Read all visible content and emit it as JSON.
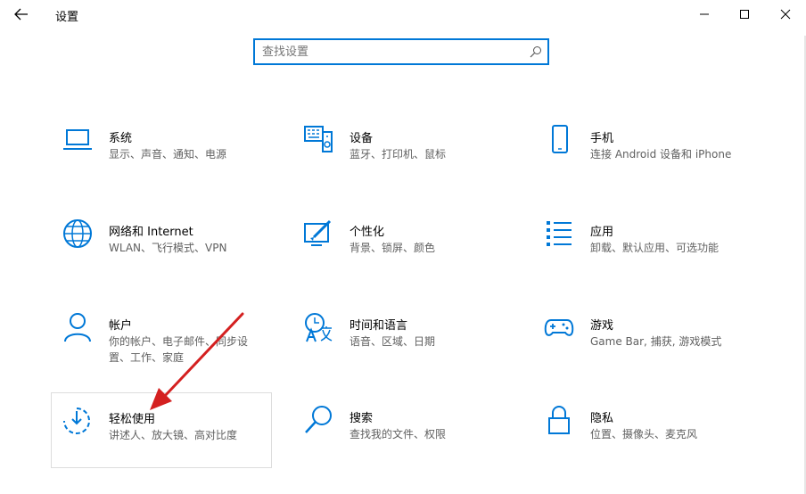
{
  "window": {
    "title": "设置"
  },
  "search": {
    "placeholder": "查找设置"
  },
  "tiles": [
    {
      "title": "系统",
      "desc": "显示、声音、通知、电源",
      "icon": "laptop-icon"
    },
    {
      "title": "设备",
      "desc": "蓝牙、打印机、鼠标",
      "icon": "devices-icon"
    },
    {
      "title": "手机",
      "desc": "连接 Android 设备和 iPhone",
      "icon": "phone-icon"
    },
    {
      "title": "网络和 Internet",
      "desc": "WLAN、飞行模式、VPN",
      "icon": "globe-icon"
    },
    {
      "title": "个性化",
      "desc": "背景、锁屏、颜色",
      "icon": "personalization-icon"
    },
    {
      "title": "应用",
      "desc": "卸载、默认应用、可选功能",
      "icon": "apps-list-icon"
    },
    {
      "title": "帐户",
      "desc": "你的帐户、电子邮件、同步设置、工作、家庭",
      "icon": "person-icon"
    },
    {
      "title": "时间和语言",
      "desc": "语音、区域、日期",
      "icon": "time-language-icon"
    },
    {
      "title": "游戏",
      "desc": "Game Bar, 捕获, 游戏模式",
      "icon": "gamepad-icon"
    },
    {
      "title": "轻松使用",
      "desc": "讲述人、放大镜、高对比度",
      "icon": "ease-of-access-icon"
    },
    {
      "title": "搜索",
      "desc": "查找我的文件、权限",
      "icon": "search-icon"
    },
    {
      "title": "隐私",
      "desc": "位置、摄像头、麦克风",
      "icon": "lock-icon"
    }
  ],
  "colors": {
    "accent": "#0078d7",
    "annotation_arrow": "#d42020"
  }
}
